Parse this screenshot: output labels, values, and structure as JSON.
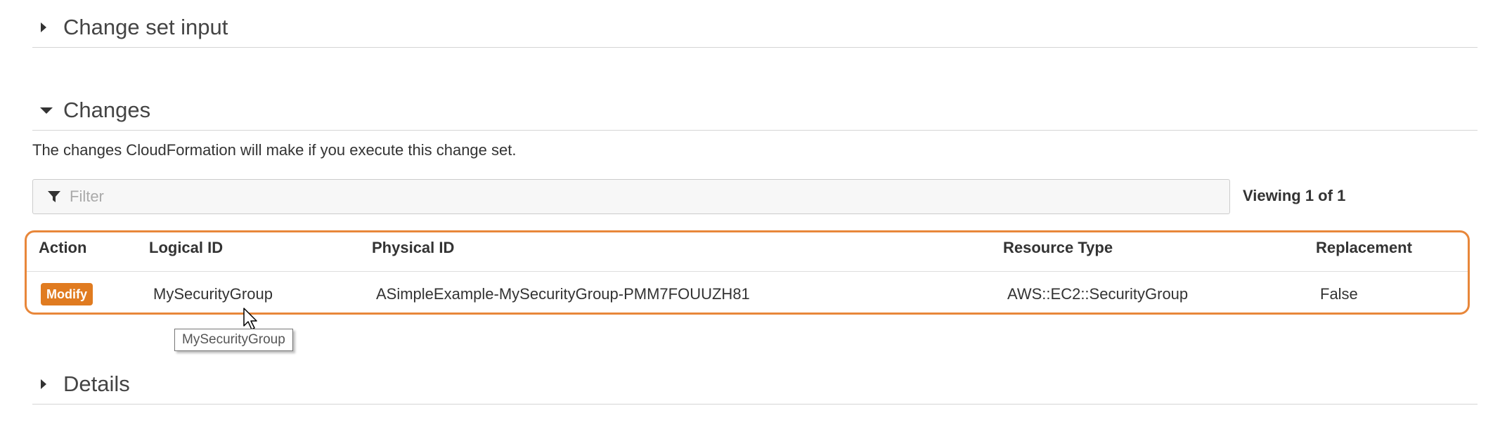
{
  "sections": {
    "change_set_input": {
      "title": "Change set input",
      "expanded": false
    },
    "changes": {
      "title": "Changes",
      "expanded": true,
      "description": "The changes CloudFormation will make if you execute this change set."
    },
    "details": {
      "title": "Details",
      "expanded": false
    }
  },
  "filter": {
    "placeholder": "Filter",
    "value": "",
    "icon": "filter-icon"
  },
  "viewing": "Viewing 1 of 1",
  "table": {
    "columns": [
      "Action",
      "Logical ID",
      "Physical ID",
      "Resource Type",
      "Replacement"
    ],
    "rows": [
      {
        "action": "Modify",
        "logical_id": "MySecurityGroup",
        "physical_id": "ASimpleExample-MySecurityGroup-PMM7FOUUZH81",
        "resource_type": "AWS::EC2::SecurityGroup",
        "replacement": "False"
      }
    ]
  },
  "tooltip": "MySecurityGroup",
  "colors": {
    "highlight_border": "#e8873a",
    "action_badge": "#e07b20"
  }
}
